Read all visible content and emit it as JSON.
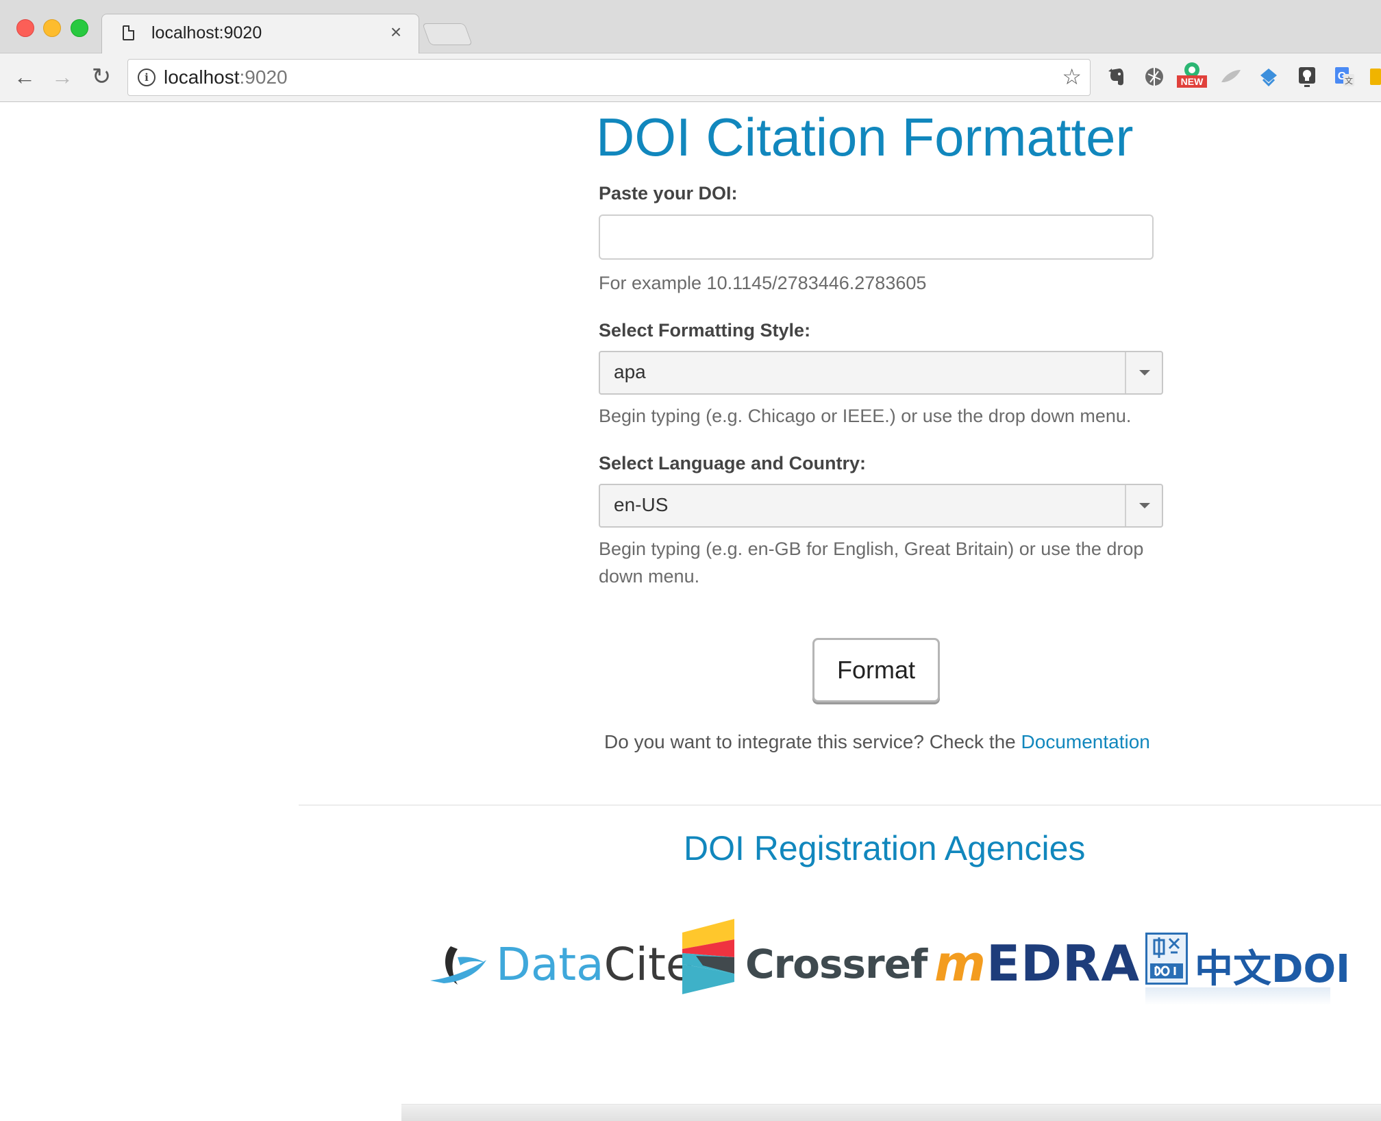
{
  "browser": {
    "tab_title": "localhost:9020",
    "tab_close": "×",
    "url_host": "localhost",
    "url_port": ":9020",
    "nav": {
      "back": "←",
      "forward": "→",
      "reload": "↻"
    },
    "star": "☆",
    "extensions": [
      {
        "icon": "evernote-icon"
      },
      {
        "icon": "extension-globe-icon"
      },
      {
        "icon": "extension-new-icon",
        "badge": "NEW"
      },
      {
        "icon": "extension-feather-icon"
      },
      {
        "icon": "extension-diamond-icon"
      },
      {
        "icon": "extension-lightbulb-icon"
      },
      {
        "icon": "google-translate-icon"
      },
      {
        "icon": "extension-yellow-icon"
      }
    ]
  },
  "page": {
    "title": "DOI Citation Formatter",
    "doi_label": "Paste your DOI:",
    "doi_value": "",
    "doi_help": "For example 10.1145/2783446.2783605",
    "style_label": "Select Formatting Style:",
    "style_value": "apa",
    "style_help": "Begin typing (e.g. Chicago or IEEE.) or use the drop down menu.",
    "lang_label": "Select Language and Country:",
    "lang_value": "en-US",
    "lang_help": "Begin typing (e.g. en-GB for English, Great Britain) or use the drop down menu.",
    "format_button": "Format",
    "integrate_text": "Do you want to integrate this service? Check the ",
    "integrate_link": "Documentation",
    "agencies_title": "DOI Registration Agencies",
    "agencies": {
      "datacite_data": "Data",
      "datacite_cite": "Cite",
      "crossref": "Crossref",
      "medra_m": "m",
      "medra_edra": "EDRA",
      "chinadoi": "中文DOI"
    }
  },
  "colors": {
    "brand_blue": "#1187bd",
    "text_gray": "#6b6b6b",
    "label_gray": "#444444"
  }
}
